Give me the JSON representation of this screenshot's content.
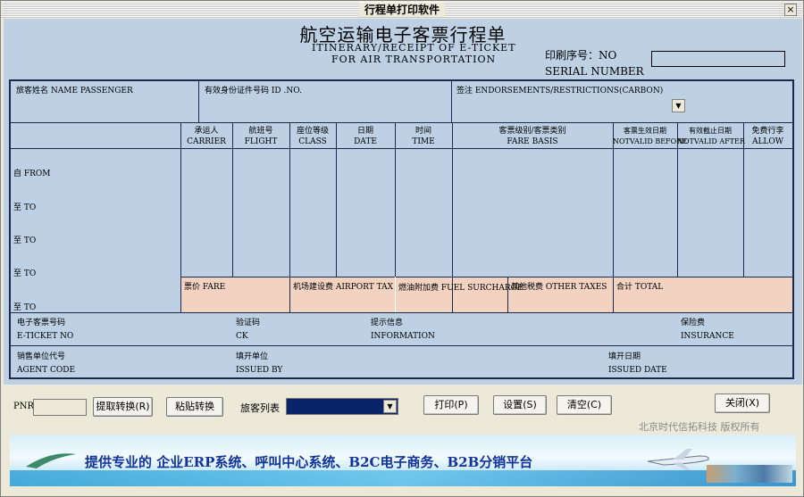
{
  "window": {
    "title": "行程单打印软件",
    "close": "×"
  },
  "header": {
    "title_cn": "航空运输电子客票行程单",
    "title_en1": "ITINERARY/RECEIPT OF E-TICKET",
    "title_en2": "FOR AIR TRANSPORTATION",
    "serial_cn": "印刷序号：NO",
    "serial_en": "SERIAL NUMBER",
    "serial_value": ""
  },
  "row1": {
    "passenger": "旅客姓名  NAME PASSENGER",
    "id_no": "有效身份证件号码  ID .NO.",
    "endorse": "签注 ENDORSEMENTS/RESTRICTIONS(CARBON)"
  },
  "columns": {
    "carrier_cn": "承运人",
    "carrier_en": "CARRIER",
    "flight_cn": "航班号",
    "flight_en": "FLIGHT",
    "class_cn": "座位等级",
    "class_en": "CLASS",
    "date_cn": "日期",
    "date_en": "DATE",
    "time_cn": "时间",
    "time_en": "TIME",
    "fare_cn": "客票级别/客票类别",
    "fare_en": "FARE BASIS",
    "nvb_cn": "客票生效日期",
    "nvb_en": "NOTVALID BEFORE",
    "nva_cn": "有效截止日期",
    "nva_en": "NOTVALID AFTER",
    "allow_cn": "免费行李",
    "allow_en": "ALLOW"
  },
  "route": {
    "from": "自 FROM",
    "to1": "至 TO",
    "to2": "至 TO",
    "to3": "至 TO",
    "to4": "至 TO"
  },
  "fares": {
    "fare": "票价 FARE",
    "airport_tax": "机场建设费  AIRPORT TAX",
    "fuel": "燃油附加费 FUEL SURCHARGE",
    "other": "其他税费 OTHER TAXES",
    "total": "合计  TOTAL"
  },
  "row_eticket": {
    "eticket_cn": "电子客票号码",
    "eticket_en": "E-TICKET NO",
    "ck_cn": "验证码",
    "ck_en": "CK",
    "info_cn": "提示信息",
    "info_en": "INFORMATION",
    "ins_cn": "保险费",
    "ins_en": "INSURANCE"
  },
  "row_agent": {
    "agent_cn": "销售单位代号",
    "agent_en": "AGENT CODE",
    "issued_cn": "填开单位",
    "issued_en": "ISSUED BY",
    "date_cn": "填开日期",
    "date_en": "ISSUED DATE"
  },
  "controls": {
    "pnr_label": "PNR",
    "pnr_value": "",
    "extract": "提取转换(R)",
    "paste": "粘贴转换",
    "pax_list": "旅客列表",
    "print": "打印(P)",
    "settings": "设置(S)",
    "clear": "清空(C)",
    "close": "关闭(X)"
  },
  "copyright": "北京时代信拓科技  版权所有",
  "banner_text": "提供专业的 企业ERP系统、呼叫中心系统、B2C电子商务、B2B分销平台"
}
